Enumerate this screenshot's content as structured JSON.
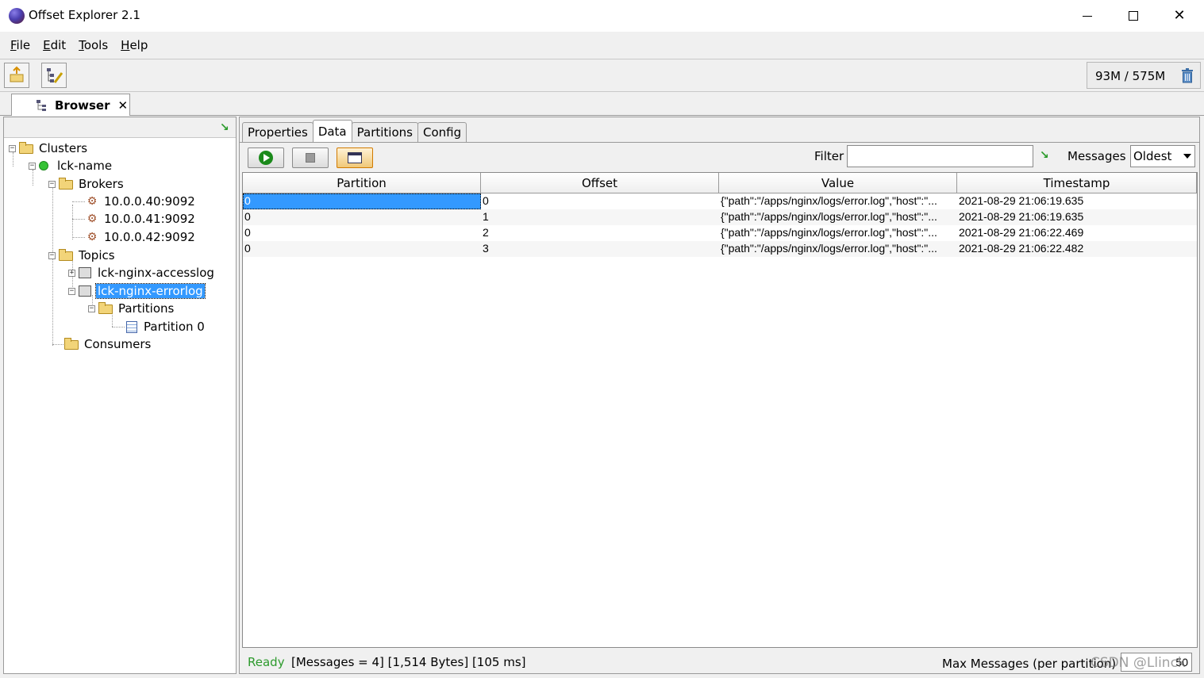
{
  "window": {
    "title": "Offset Explorer  2.1"
  },
  "menu": {
    "items": [
      {
        "label": "File",
        "mnemonic": "F",
        "rest": "ile"
      },
      {
        "label": "Edit",
        "mnemonic": "E",
        "rest": "dit"
      },
      {
        "label": "Tools",
        "mnemonic": "T",
        "rest": "ools"
      },
      {
        "label": "Help",
        "mnemonic": "H",
        "rest": "elp"
      }
    ]
  },
  "toolbar": {
    "memory": "93M / 575M"
  },
  "browser_tab": {
    "label": "Browser",
    "close": "✕"
  },
  "tree": {
    "clusters": "Clusters",
    "cluster_name": "lck-name",
    "brokers": "Brokers",
    "broker_1": "10.0.0.40:9092",
    "broker_2": "10.0.0.41:9092",
    "broker_3": "10.0.0.42:9092",
    "topics": "Topics",
    "topic_1": "lck-nginx-accesslog",
    "topic_2": "lck-nginx-errorlog",
    "partitions": "Partitions",
    "partition_0": "Partition 0",
    "consumers": "Consumers"
  },
  "subtabs": {
    "properties": "Properties",
    "data": "Data",
    "partitions": "Partitions",
    "config": "Config"
  },
  "data_toolbar": {
    "filter_label": "Filter",
    "filter_value": "",
    "messages_label": "Messages",
    "messages_selected": "Oldest"
  },
  "table": {
    "columns": [
      "Partition",
      "Offset",
      "Value",
      "Timestamp"
    ],
    "rows": [
      [
        "0",
        "0",
        "{\"path\":\"/apps/nginx/logs/error.log\",\"host\":\"...",
        "2021-08-29 21:06:19.635"
      ],
      [
        "0",
        "1",
        "{\"path\":\"/apps/nginx/logs/error.log\",\"host\":\"...",
        "2021-08-29 21:06:19.635"
      ],
      [
        "0",
        "2",
        "{\"path\":\"/apps/nginx/logs/error.log\",\"host\":\"...",
        "2021-08-29 21:06:22.469"
      ],
      [
        "0",
        "3",
        "{\"path\":\"/apps/nginx/logs/error.log\",\"host\":\"...",
        "2021-08-29 21:06:22.482"
      ]
    ]
  },
  "status": {
    "ready": "Ready",
    "info": "[Messages = 4]  [1,514 Bytes]  [105 ms]",
    "max_messages_label": "Max Messages (per partition)",
    "max_messages_value": "50"
  },
  "watermark": "CSDN @Llinck",
  "colors": {
    "selection": "#3399ff",
    "ready_green": "#2c9a2c"
  }
}
